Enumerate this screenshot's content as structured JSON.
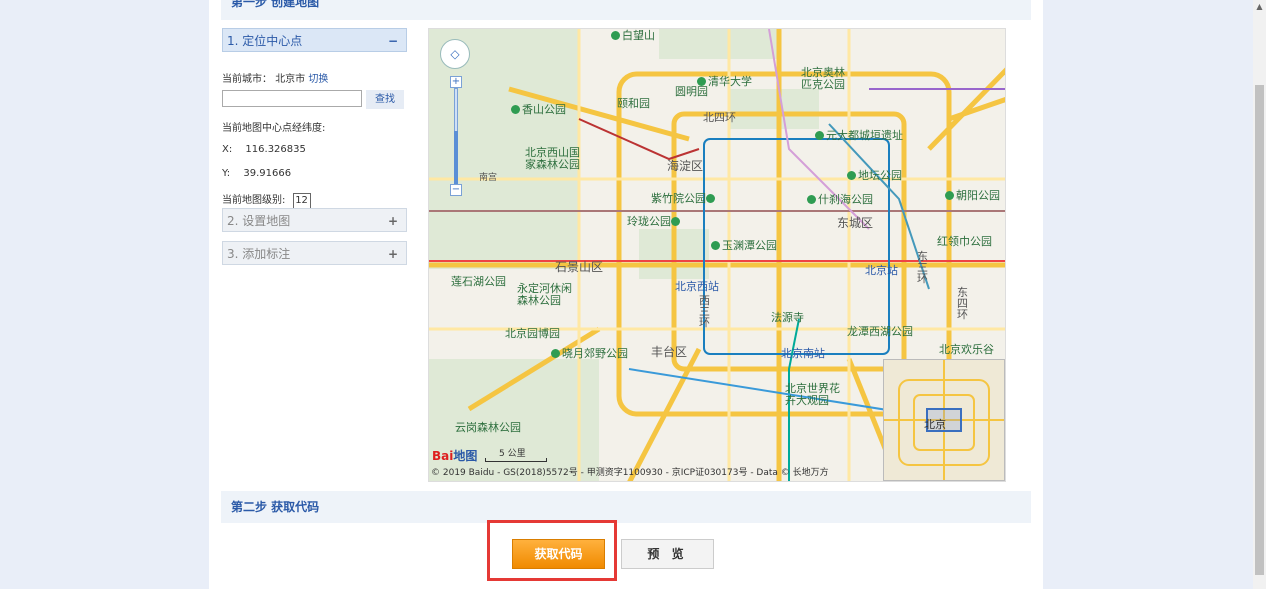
{
  "step1": {
    "title": "第一步 创建地图"
  },
  "sidebar": {
    "section1": {
      "label": "1. 定位中心点",
      "toggle": "−"
    },
    "current_city_label": "当前城市：",
    "current_city": "北京市",
    "switch_link": "切换",
    "search_button": "查找",
    "search_value": "",
    "center_label": "当前地图中心点经纬度:",
    "x_label": "X:",
    "x_value": "116.326835",
    "y_label": "Y:",
    "y_value": "39.91666",
    "zoom_label": "当前地图级别:",
    "zoom_value": "12",
    "section2": {
      "label": "2. 设置地图",
      "toggle": "+"
    },
    "section3": {
      "label": "3. 添加标注",
      "toggle": "+"
    }
  },
  "map": {
    "labels": {
      "l1": "白望山",
      "l2": "清华大学",
      "l3": "北京奥林匹克公园",
      "l4": "香山公园",
      "l5": "颐和园",
      "l6": "圆明园",
      "l7": "北四环",
      "l8": "元大都城垣遗址",
      "l9": "北京西山国家森林公园",
      "l10": "海淀区",
      "l11": "地坛公园",
      "l12": "紫竹院公园",
      "l13": "什刹海公园",
      "l14": "玲珑公园",
      "l15": "东城区",
      "l16": "朝阳公园",
      "l17": "玉渊潭公园",
      "l18": "红领巾公园",
      "l19": "石景山区",
      "l20": "北京站",
      "l21": "东三环",
      "l22": "莲石湖公园",
      "l23": "北京西站",
      "l24": "永定河休闲森林公园",
      "l25": "西三环",
      "l26": "东四环",
      "l27": "北京园博园",
      "l28": "法源寺",
      "l29": "龙潭西湖公园",
      "l30": "晓月郊野公园",
      "l31": "丰台区",
      "l32": "北京南站",
      "l33": "北京欢乐谷",
      "l34": "北京世界花卉大观园",
      "l35": "云岗森林公园",
      "l36": "南宫",
      "inset_label": "北京"
    },
    "zoom_in": "+",
    "zoom_out": "−",
    "scale_label": "5 公里",
    "copyright": "© 2019 Baidu - GS(2018)5572号 - 甲测资字1100930 - 京ICP证030173号 - Data © 长地万方",
    "logo_left": "Bai",
    "logo_right": "地图"
  },
  "step2": {
    "title": "第二步 获取代码"
  },
  "buttons": {
    "get_code": "获取代码",
    "preview": "预 览"
  },
  "colors": {
    "accent": "#2b5aa8",
    "button_orange": "#f39800",
    "highlight_red": "#e53935"
  }
}
